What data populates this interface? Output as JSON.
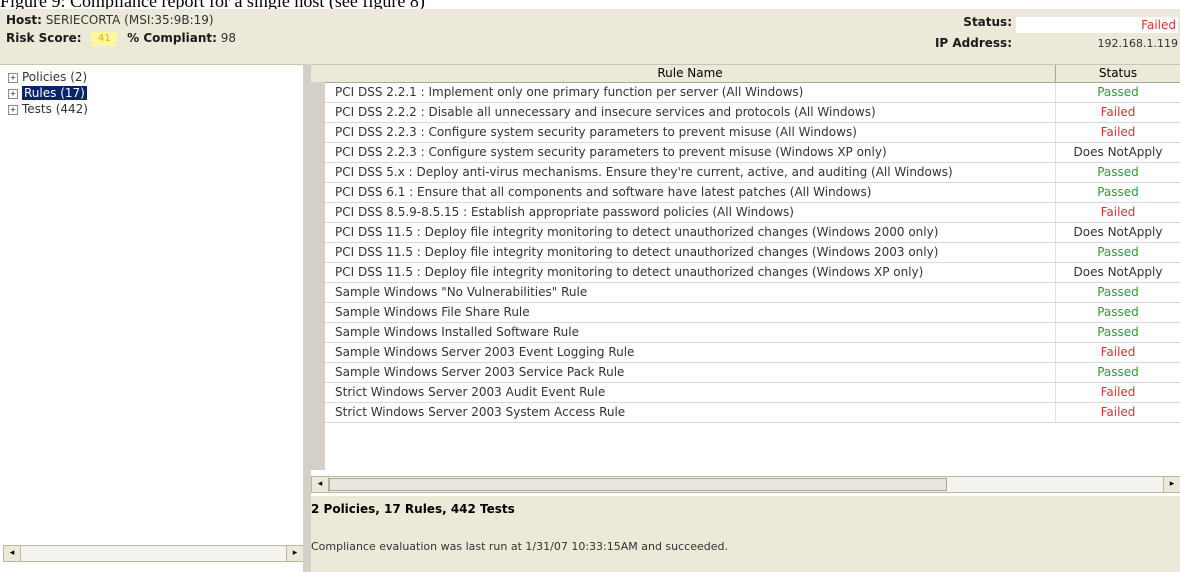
{
  "caption": "Figure 9: Compliance report for a single host (see figure 8)",
  "header": {
    "host_label": "Host:",
    "host_value": "SERIECORTA (MSI:35:9B:19)",
    "risk_label": "Risk Score:",
    "risk_value": "41",
    "compliant_label": "% Compliant:",
    "compliant_value": "98",
    "status_label": "Status:",
    "status_value": "Failed",
    "ip_label": "IP Address:",
    "ip_value": "192.168.1.119"
  },
  "tree": {
    "items": [
      {
        "toggle": "+",
        "label": "Policies (2)"
      },
      {
        "toggle": "+",
        "label": "Rules (17)"
      },
      {
        "toggle": "+",
        "label": "Tests (442)"
      }
    ]
  },
  "grid": {
    "columns": [
      "Rule Name",
      "Status"
    ],
    "rows": [
      {
        "name": "PCI DSS  2.2.1 : Implement only one primary function per server (All Windows)",
        "status": "Passed"
      },
      {
        "name": "PCI DSS  2.2.2 : Disable all unnecessary and insecure services and protocols (All Windows)",
        "status": "Failed"
      },
      {
        "name": "PCI DSS  2.2.3 : Configure system security parameters to prevent misuse (All Windows)",
        "status": "Failed"
      },
      {
        "name": "PCI DSS  2.2.3 : Configure system security parameters to prevent misuse (Windows XP only)",
        "status": "Does NotApply"
      },
      {
        "name": "PCI DSS  5.x : Deploy anti-virus mechanisms. Ensure they're current, active, and auditing (All Windows)",
        "status": "Passed"
      },
      {
        "name": "PCI DSS  6.1 : Ensure that all components and software have latest patches (All Windows)",
        "status": "Passed"
      },
      {
        "name": "PCI DSS  8.5.9-8.5.15 : Establish appropriate password policies (All Windows)",
        "status": "Failed"
      },
      {
        "name": "PCI DSS  11.5 : Deploy file integrity monitoring to detect unauthorized changes (Windows 2000 only)",
        "status": "Does NotApply"
      },
      {
        "name": "PCI DSS  11.5 : Deploy file integrity monitoring to detect unauthorized changes (Windows 2003 only)",
        "status": "Passed"
      },
      {
        "name": "PCI DSS  11.5 : Deploy file integrity monitoring to detect unauthorized changes (Windows XP only)",
        "status": "Does NotApply"
      },
      {
        "name": "Sample Windows \"No Vulnerabilities\" Rule",
        "status": "Passed"
      },
      {
        "name": "Sample Windows File Share Rule",
        "status": "Passed"
      },
      {
        "name": "Sample Windows Installed Software Rule",
        "status": "Passed"
      },
      {
        "name": "Sample Windows Server 2003 Event Logging Rule",
        "status": "Failed"
      },
      {
        "name": "Sample Windows Server 2003 Service Pack Rule",
        "status": "Passed"
      },
      {
        "name": "Strict Windows Server 2003 Audit Event Rule",
        "status": "Failed"
      },
      {
        "name": "Strict Windows Server 2003 System Access Rule",
        "status": "Failed"
      }
    ]
  },
  "summary": {
    "title": "2 Policies, 17 Rules, 442 Tests",
    "text": "Compliance evaluation was last run at 1/31/07 10:33:15AM and succeeded."
  },
  "colors": {
    "passed": "#2a9d3a",
    "failed": "#e03030",
    "not_apply": "#333333"
  },
  "icons": {
    "scroll_left": "scroll-left-arrow-icon",
    "scroll_right": "scroll-right-arrow-icon",
    "tree_expand": "tree-expand-icon"
  }
}
